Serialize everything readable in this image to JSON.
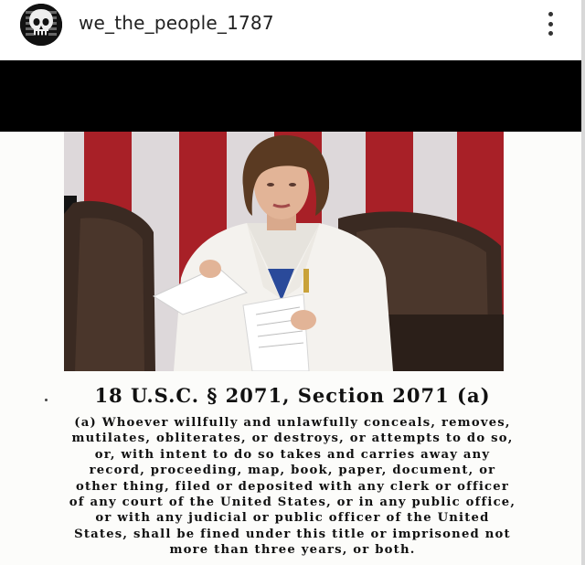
{
  "header": {
    "username": "we_the_people_1787",
    "avatar_icon": "skull-flag-icon",
    "more_icon": "more-options-icon"
  },
  "post": {
    "title": "18 U.S.C. § 2071, Section 2071 (a)",
    "body": "(a) Whoever willfully and unlawfully conceals, removes,\nmutilates, obliterates, or destroys, or attempts to do so,\nor, with intent to do so takes and carries away any\nrecord, proceeding, map, book, paper, document, or\nother thing, filed or deposited with any clerk or officer\nof any court of the United States, or in any public office,\nor with any judicial or public officer of the United\nStates, shall be fined under this title or imprisoned not\nmore than three years, or both."
  },
  "colors": {
    "band": "#000000",
    "flag_red": "#b2222a",
    "flag_white": "#e9e4e6",
    "suit_white": "#f4f2ee",
    "chair_leather": "#3a2a22"
  }
}
